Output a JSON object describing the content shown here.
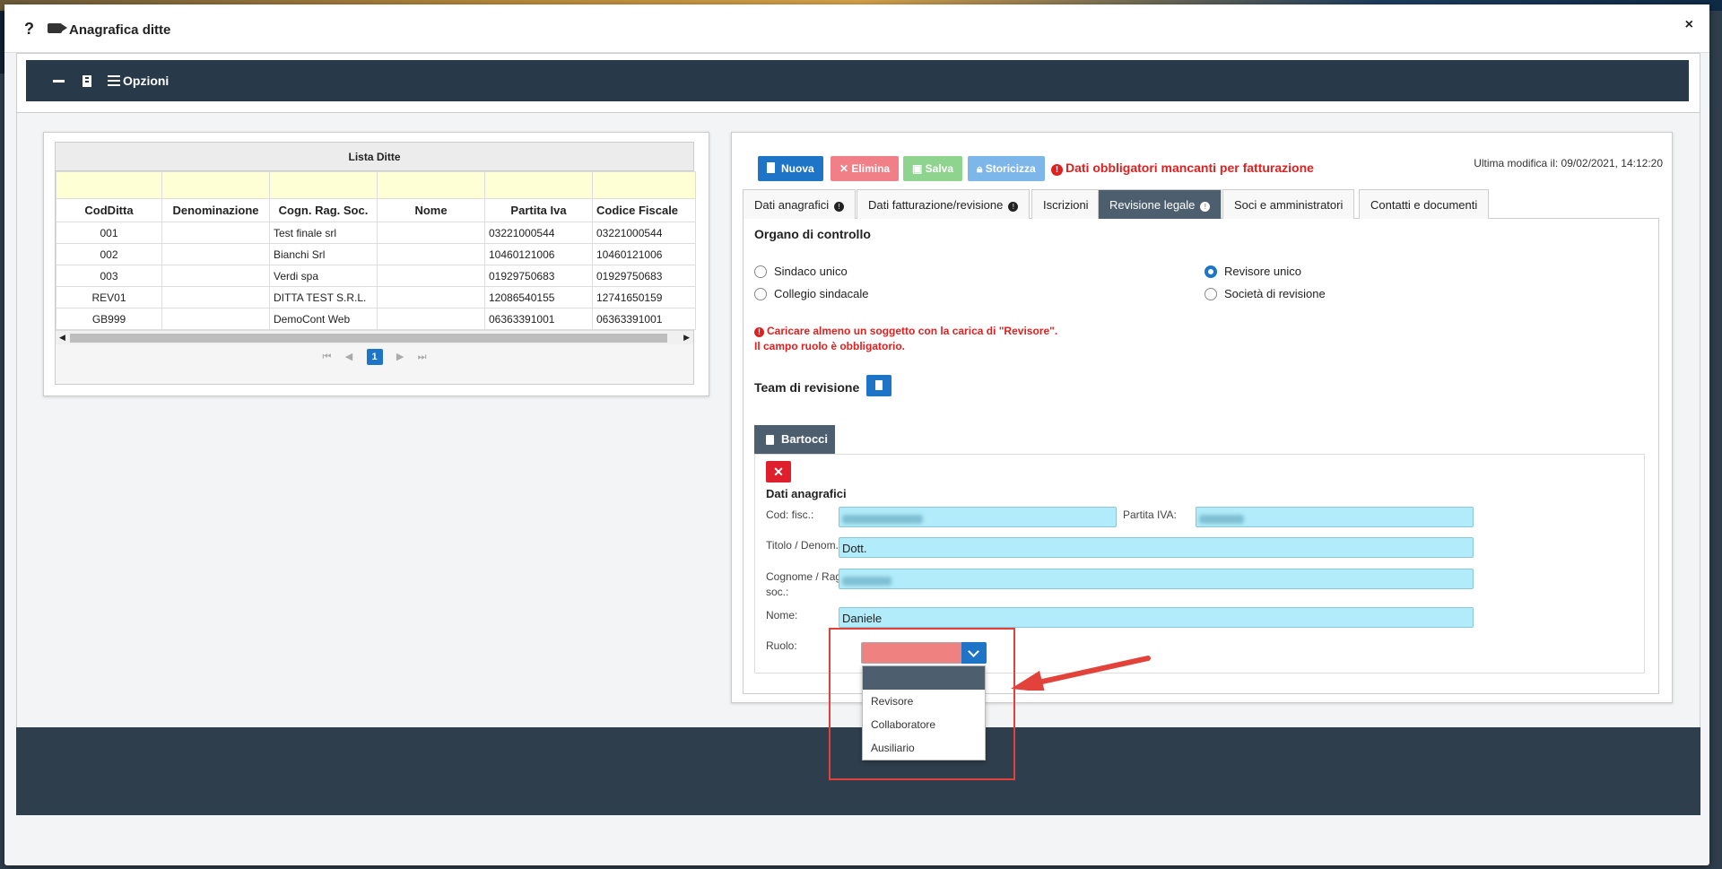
{
  "window": {
    "title": "Anagrafica ditte",
    "help": "?",
    "close": "×"
  },
  "toolbar": {
    "options_label": "Opzioni"
  },
  "list": {
    "caption": "Lista Ditte",
    "columns": [
      "CodDitta",
      "Denominazione",
      "Cogn. Rag. Soc.",
      "Nome",
      "Partita Iva",
      "Codice Fiscale"
    ],
    "rows": [
      [
        "001",
        "",
        "Test finale srl",
        "",
        "03221000544",
        "03221000544"
      ],
      [
        "002",
        "",
        "Bianchi Srl",
        "",
        "10460121006",
        "10460121006"
      ],
      [
        "003",
        "",
        "Verdi spa",
        "",
        "01929750683",
        "01929750683"
      ],
      [
        "REV01",
        "",
        "DITTA TEST S.R.L.",
        "",
        "12086540155",
        "12741650159"
      ],
      [
        "GB999",
        "",
        "DemoCont Web",
        "",
        "06363391001",
        "06363391001"
      ]
    ],
    "page": "1"
  },
  "actions": {
    "new": "Nuova",
    "delete": "Elimina",
    "save": "Salva",
    "history": "Storicizza"
  },
  "warning": "Dati obbligatori mancanti per fatturazione",
  "last_modified": "Ultima modifica il: 09/02/2021, 14:12:20",
  "tabs": [
    "Dati anagrafici",
    "Dati fatturazione/revisione",
    "Iscrizioni",
    "Revisione legale",
    "Soci e amministratori",
    "Contatti e documenti"
  ],
  "organo": {
    "title": "Organo di controllo",
    "options": [
      "Sindaco unico",
      "Collegio sindacale",
      "Revisore unico",
      "Società di revisione"
    ],
    "selected": "Revisore unico"
  },
  "errors": {
    "line1": "Caricare almeno un soggetto con la carica di \"Revisore\".",
    "line2": "Il campo ruolo è obbligatorio."
  },
  "team": {
    "title": "Team di revisione",
    "member_tab": "Bartocci"
  },
  "member": {
    "section": "Dati anagrafici",
    "cod_fisc_label": "Cod: fisc.:",
    "piva_label": "Partita IVA:",
    "titolo_label": "Titolo / Denom.:",
    "titolo_value": "Dott.",
    "cognome_label_1": "Cognome / Rag.",
    "cognome_label_2": "soc.:",
    "nome_label": "Nome:",
    "nome_value": "Daniele",
    "ruolo_label": "Ruolo:",
    "ruolo_options": [
      "Revisore",
      "Collaboratore",
      "Ausiliario"
    ]
  },
  "colors": {
    "accent": "#1e74c7",
    "danger": "#e01f2d",
    "field": "#b2ecfa",
    "header_dark": "#283a49"
  }
}
